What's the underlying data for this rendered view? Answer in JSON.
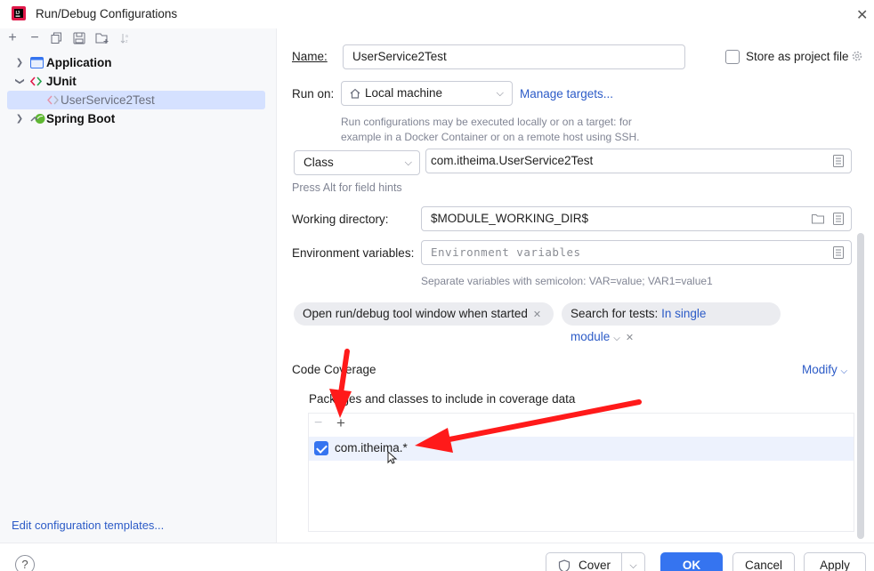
{
  "window": {
    "title": "Run/Debug Configurations"
  },
  "toolbar": {
    "icons": [
      "add-icon",
      "remove-icon",
      "copy-icon",
      "save-icon",
      "new-folder-icon",
      "sort-icon"
    ]
  },
  "tree": {
    "items": [
      {
        "label": "Application",
        "icon": "application-icon"
      },
      {
        "label": "JUnit",
        "icon": "junit-icon"
      },
      {
        "label": "UserService2Test",
        "icon": "junit-test-icon"
      },
      {
        "label": "Spring Boot",
        "icon": "spring-boot-icon"
      }
    ]
  },
  "left_footer": {
    "edit_templates": "Edit configuration templates..."
  },
  "form": {
    "name_label": "Name:",
    "name_value": "UserService2Test",
    "store_project_label": "Store as project file",
    "run_on_label": "Run on:",
    "run_on_value": "Local machine",
    "manage_targets": "Manage targets...",
    "run_on_hint_1": "Run configurations may be executed locally or on a target: for",
    "run_on_hint_2": "example in a Docker Container or on a remote host using SSH.",
    "test_kind_value": "Class",
    "class_value": "com.itheima.UserService2Test",
    "field_hint": "Press Alt for field hints",
    "working_dir_label": "Working directory:",
    "working_dir_value": "$MODULE_WORKING_DIR$",
    "env_label": "Environment variables:",
    "env_placeholder": "Environment variables",
    "env_hint": "Separate variables with semicolon: VAR=value; VAR1=value1",
    "chip_tool_window": "Open run/debug tool window when started",
    "chip_search_prefix": "Search for tests:",
    "chip_search_value": "In single module",
    "coverage_title": "Code Coverage",
    "modify": "Modify",
    "coverage_subtitle": "Packages and classes to include in coverage data",
    "coverage_entry": "com.itheima.*"
  },
  "buttons": {
    "cover": "Cover",
    "ok": "OK",
    "cancel": "Cancel",
    "apply": "Apply",
    "help": "?"
  },
  "colors": {
    "accent": "#3574f0",
    "link": "#2c5bc7",
    "annotation": "#ff1a1a"
  }
}
